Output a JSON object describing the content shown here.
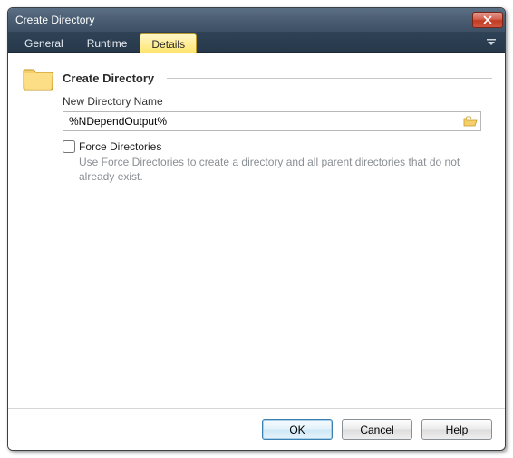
{
  "window": {
    "title": "Create Directory"
  },
  "tabs": {
    "general": "General",
    "runtime": "Runtime",
    "details": "Details"
  },
  "section": {
    "title": "Create Directory",
    "new_dir_label": "New Directory Name",
    "new_dir_value": "%NDependOutput%",
    "force_label": "Force Directories",
    "force_desc": "Use Force Directories to create a directory and all parent directories that do not already exist."
  },
  "buttons": {
    "ok": "OK",
    "cancel": "Cancel",
    "help": "Help"
  }
}
